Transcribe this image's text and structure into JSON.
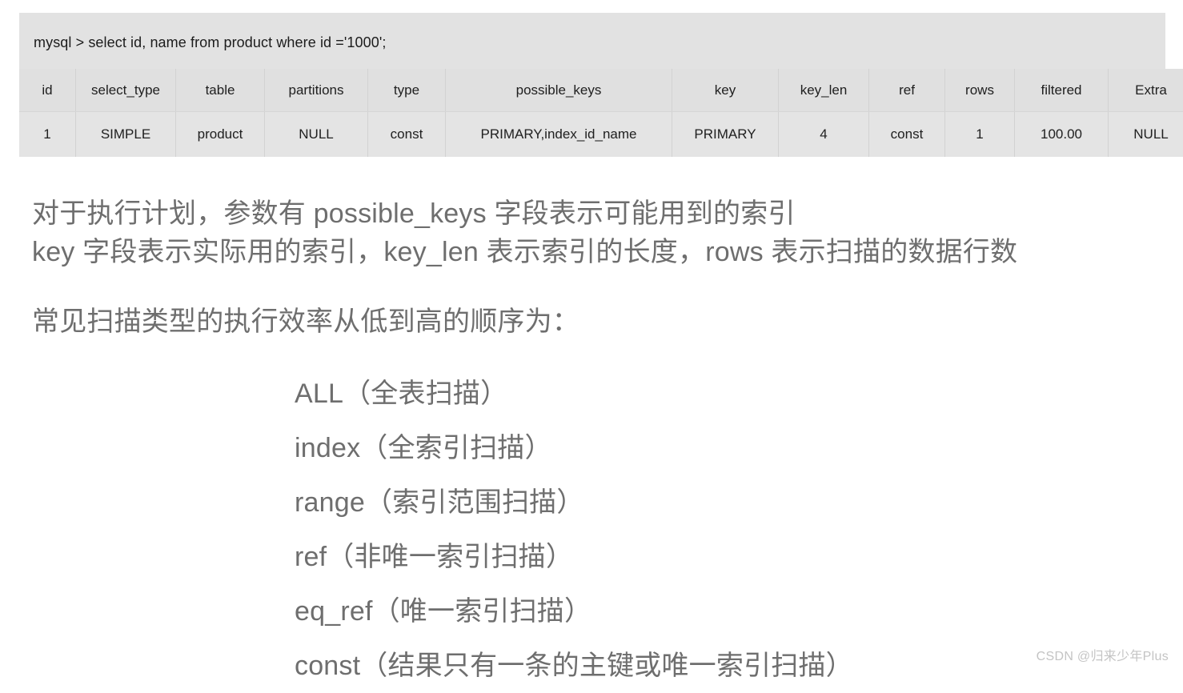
{
  "explain": {
    "sql": "mysql > select id, name from product where id ='1000';",
    "columns": [
      "id",
      "select_type",
      "table",
      "partitions",
      "type",
      "possible_keys",
      "key",
      "key_len",
      "ref",
      "rows",
      "filtered",
      "Extra"
    ],
    "rows": [
      {
        "id": "1",
        "select_type": "SIMPLE",
        "table": "product",
        "partitions": "NULL",
        "type": "const",
        "possible_keys": "PRIMARY,index_id_name",
        "key": "PRIMARY",
        "key_len": "4",
        "ref": "const",
        "rows": "1",
        "filtered": "100.00",
        "extra": "NULL"
      }
    ]
  },
  "notes": {
    "paragraph_lines": [
      "对于执行计划，参数有 possible_keys 字段表示可能用到的索引",
      "key 字段表示实际用的索引，key_len 表示索引的长度，rows 表示扫描的数据行数"
    ],
    "lead": "常见扫描类型的执行效率从低到高的顺序为："
  },
  "scan_types": [
    "ALL（全表扫描）",
    "index（全索引扫描）",
    "range（索引范围扫描）",
    "ref（非唯一索引扫描）",
    "eq_ref（唯一索引扫描）",
    "const（结果只有一条的主键或唯一索引扫描）"
  ],
  "watermark": "CSDN @归来少年Plus",
  "colors": {
    "panel_background": "#e2e2e2",
    "header_row": "#e0e0e0",
    "data_row": "#e4e4e4",
    "body_text": "#6e6e6e",
    "table_text": "#202020",
    "watermark_text": "#c4c4c4"
  }
}
